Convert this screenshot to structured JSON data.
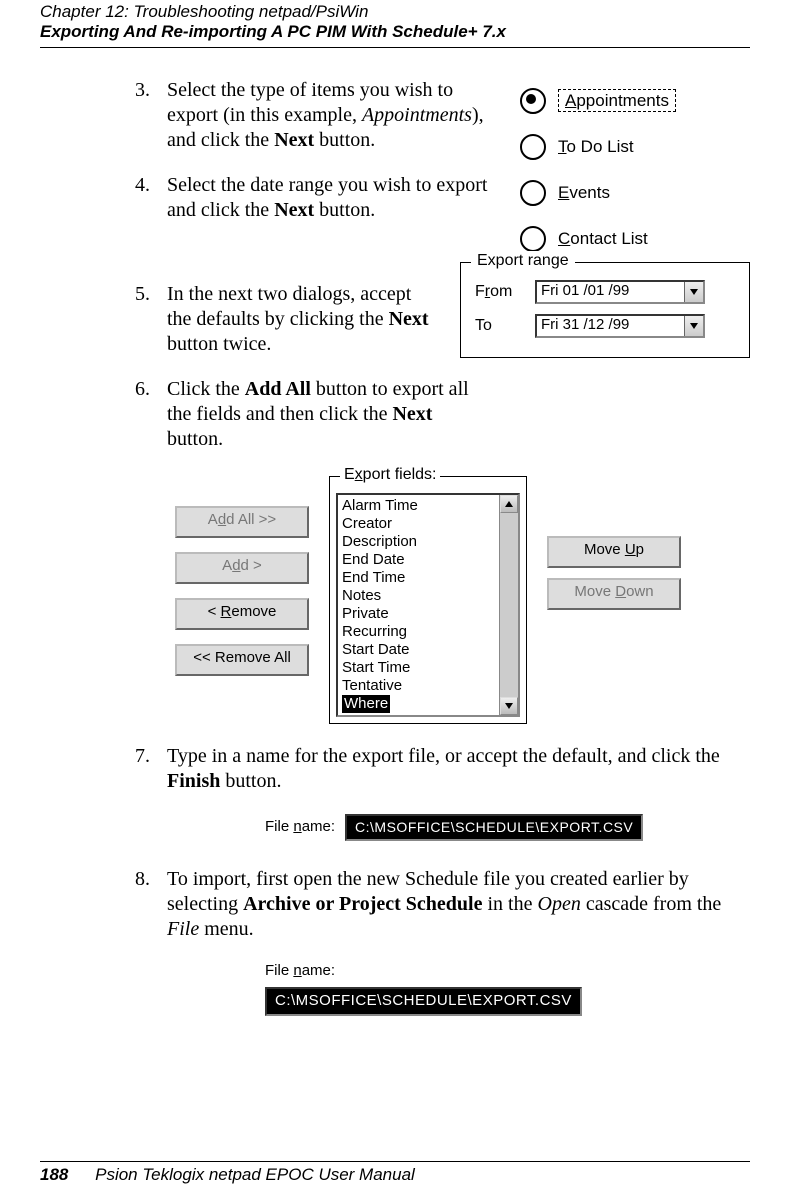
{
  "header": {
    "line1": "Chapter 12:  Troubleshooting netpad/PsiWin",
    "line2": "Exporting And Re-importing A PC PIM With Schedule+ 7.x"
  },
  "steps": {
    "s3": {
      "num": "3.",
      "text_a": "Select the type of items you wish to export (in this example, ",
      "ital": "Appointments",
      "text_b": "), and click the ",
      "bold": "Next",
      "text_c": " button."
    },
    "s4": {
      "num": "4.",
      "text_a": "Select the date range you wish to export and click the ",
      "bold": "Next",
      "text_b": " button."
    },
    "s5": {
      "num": "5.",
      "text_a": "In the next two dialogs, accept the defaults by clicking the ",
      "bold": "Next",
      "text_b": " button twice."
    },
    "s6": {
      "num": "6.",
      "text_a": "Click the ",
      "bold1": "Add All",
      "text_b": " button to export all the fields and then click the ",
      "bold2": "Next",
      "text_c": " button."
    },
    "s7": {
      "num": "7.",
      "text_a": "Type in a name for the export file, or accept the default, and click the ",
      "bold": "Finish",
      "text_b": " button."
    },
    "s8": {
      "num": "8.",
      "text_a": "To import, first open the new Schedule file you created earlier by selecting ",
      "bold": "Archive or Project Schedule",
      "text_b": " in the ",
      "ital1": "Open",
      "text_c": " cascade from the ",
      "ital2": "File",
      "text_d": " menu."
    }
  },
  "radio_options": {
    "o0": {
      "prefix": "A",
      "rest": "ppointments",
      "selected": true
    },
    "o1": {
      "prefix": "T",
      "rest": "o Do List",
      "selected": false
    },
    "o2": {
      "prefix": "E",
      "rest": "vents",
      "selected": false
    },
    "o3": {
      "prefix": "C",
      "rest": "ontact List",
      "selected": false
    }
  },
  "export_range": {
    "legend": "Export range",
    "from_label_pref": "F",
    "from_label_u": "r",
    "from_label_suf": "om",
    "to_label": "To",
    "from_value": "Fri    01 /01 /99",
    "to_value": "Fri    31 /12 /99"
  },
  "fields_fig": {
    "legend_pref": "E",
    "legend_u": "x",
    "legend_suf": "port fields:",
    "btn_addall_pref": "A",
    "btn_addall_u": "d",
    "btn_addall_suf": "d All >>",
    "btn_add_pref": "A",
    "btn_add_u": "d",
    "btn_add_suf": "d >",
    "btn_remove_pref": "< ",
    "btn_remove_u": "R",
    "btn_remove_suf": "emove",
    "btn_removeall": "<< Remove All",
    "btn_moveup_pref": "Move ",
    "btn_moveup_u": "U",
    "btn_moveup_suf": "p",
    "btn_movedn_pref": "Move ",
    "btn_movedn_u": "D",
    "btn_movedn_suf": "own",
    "items": {
      "i0": "Alarm Time",
      "i1": "Creator",
      "i2": "Description",
      "i3": "End Date",
      "i4": "End Time",
      "i5": "Notes",
      "i6": "Private",
      "i7": "Recurring",
      "i8": "Start Date",
      "i9": "Start Time",
      "i10": "Tentative",
      "i11": "Where"
    }
  },
  "file1": {
    "label_pref": "File ",
    "label_u": "n",
    "label_suf": "ame:",
    "value": "C:\\MSOFFICE\\SCHEDULE\\EXPORT.CSV"
  },
  "file2": {
    "label_pref": "File ",
    "label_u": "n",
    "label_suf": "ame:",
    "value": "C:\\MSOFFICE\\SCHEDULE\\EXPORT.CSV"
  },
  "footer": {
    "page": "188",
    "text": "Psion Teklogix netpad EPOC User Manual"
  }
}
